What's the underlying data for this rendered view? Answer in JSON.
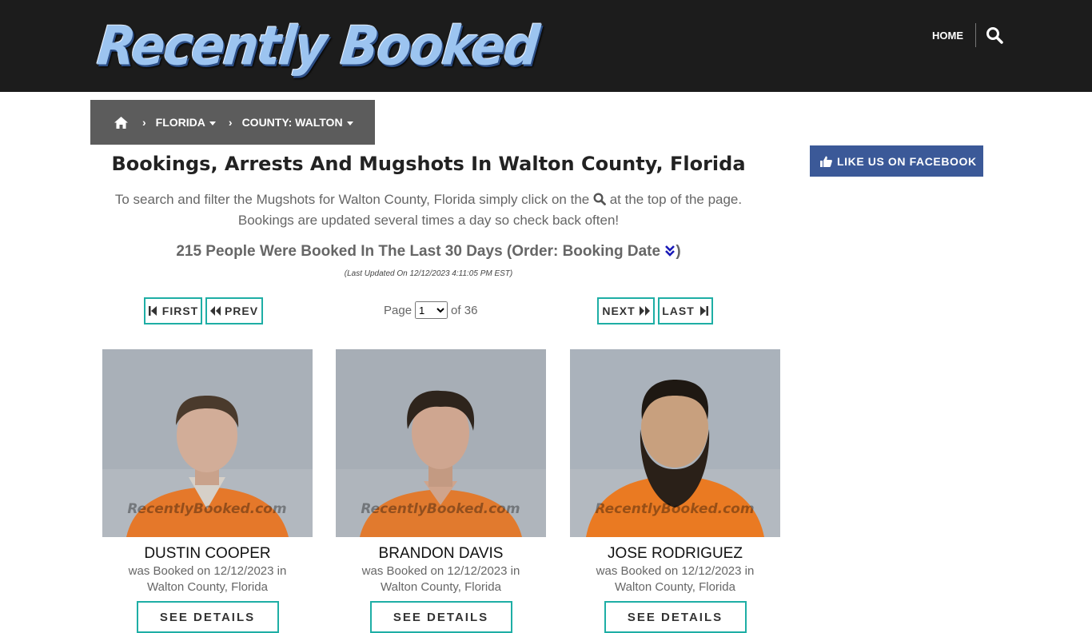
{
  "header": {
    "logo_text": "Recently Booked",
    "nav_home": "HOME",
    "search_icon": "search-icon"
  },
  "breadcrumb": {
    "home_icon": "home-icon",
    "separator": "›",
    "state": "FLORIDA",
    "county": "COUNTY: WALTON"
  },
  "facebook": {
    "label": "LIKE US ON FACEBOOK",
    "icon": "thumbs-up-icon",
    "color": "#3b5998"
  },
  "main": {
    "title": "Bookings, Arrests And Mugshots In Walton County, Florida",
    "intro_before": "To search and filter the Mugshots for Walton County, Florida simply click on the",
    "intro_after": "at the top of the page.",
    "intro_line2": "Bookings are updated several times a day so check back often!",
    "count_text": "215 People Were Booked In The Last 30 Days (Order: Booking Date",
    "count_close": ")",
    "last_updated": "(Last Updated On 12/12/2023 4:11:05 PM EST)"
  },
  "pager": {
    "first": "FIRST",
    "prev": "PREV",
    "next": "NEXT",
    "last": "LAST",
    "page_label": "Page",
    "page_value": "1",
    "of_label": "of 36",
    "accent": "#1eaea5"
  },
  "bookings": [
    {
      "name": "DUSTIN COOPER",
      "booked_line1": "was Booked on 12/12/2023 in",
      "booked_line2": "Walton County, Florida",
      "button": "SEE DETAILS",
      "watermark": "RecentlyBooked.com"
    },
    {
      "name": "BRANDON DAVIS",
      "booked_line1": "was Booked on 12/12/2023 in",
      "booked_line2": "Walton County, Florida",
      "button": "SEE DETAILS",
      "watermark": "RecentlyBooked.com"
    },
    {
      "name": "JOSE RODRIGUEZ",
      "booked_line1": "was Booked on 12/12/2023 in",
      "booked_line2": "Walton County, Florida",
      "button": "SEE DETAILS",
      "watermark": "RecentlyBooked.com"
    }
  ]
}
